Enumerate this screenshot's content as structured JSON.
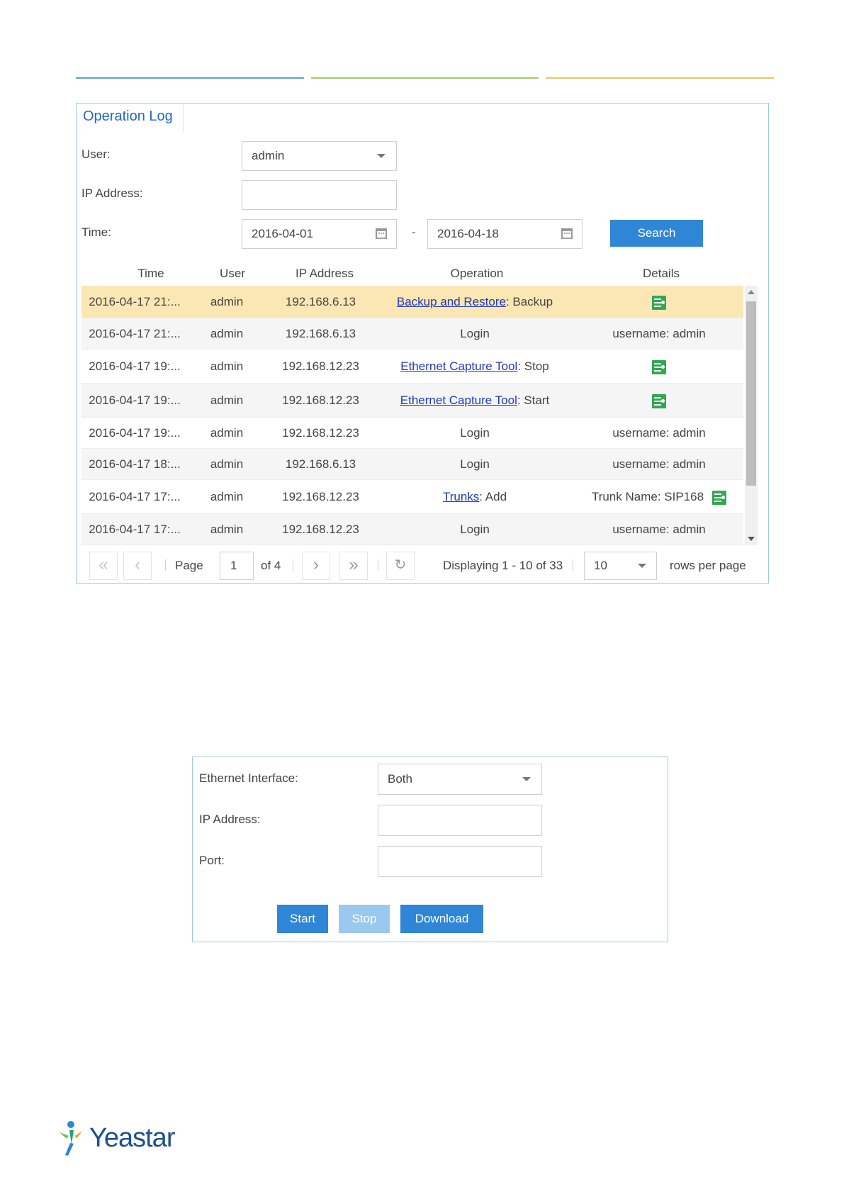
{
  "operation_log": {
    "title": "Operation Log",
    "user_label": "User:",
    "user_value": "admin",
    "ip_label": "IP Address:",
    "ip_value": "",
    "time_label": "Time:",
    "time_from": "2016-04-01",
    "time_separator": "-",
    "time_to": "2016-04-18",
    "search_label": "Search",
    "columns": [
      "Time",
      "User",
      "IP Address",
      "Operation",
      "Details"
    ],
    "rows": [
      {
        "time": "2016-04-17 21:...",
        "user": "admin",
        "ip": "192.168.6.13",
        "op_link": "Backup and Restore",
        "op_text": ": Backup",
        "details": "",
        "details_icon": "log-detail-icon"
      },
      {
        "time": "2016-04-17 21:...",
        "user": "admin",
        "ip": "192.168.6.13",
        "op_link": "",
        "op_text": "Login",
        "details": "username: admin",
        "details_icon": ""
      },
      {
        "time": "2016-04-17 19:...",
        "user": "admin",
        "ip": "192.168.12.23",
        "op_link": "Ethernet Capture Tool",
        "op_text": ": Stop",
        "details": "",
        "details_icon": "log-detail-icon"
      },
      {
        "time": "2016-04-17 19:...",
        "user": "admin",
        "ip": "192.168.12.23",
        "op_link": "Ethernet Capture Tool",
        "op_text": ": Start",
        "details": "",
        "details_icon": "log-detail-icon"
      },
      {
        "time": "2016-04-17 19:...",
        "user": "admin",
        "ip": "192.168.12.23",
        "op_link": "",
        "op_text": "Login",
        "details": "username: admin",
        "details_icon": ""
      },
      {
        "time": "2016-04-17 18:...",
        "user": "admin",
        "ip": "192.168.6.13",
        "op_link": "",
        "op_text": "Login",
        "details": "username: admin",
        "details_icon": ""
      },
      {
        "time": "2016-04-17 17:...",
        "user": "admin",
        "ip": "192.168.12.23",
        "op_link": "Trunks",
        "op_text": ": Add",
        "details": "Trunk Name: SIP168",
        "details_icon": "log-detail-icon"
      },
      {
        "time": "2016-04-17 17:...",
        "user": "admin",
        "ip": "192.168.12.23",
        "op_link": "",
        "op_text": "Login",
        "details": "username: admin",
        "details_icon": ""
      }
    ],
    "pager": {
      "page_label": "Page",
      "page_value": "1",
      "of_label": "of 4",
      "display_text": "Displaying 1 - 10 of 33",
      "rows_value": "10",
      "rows_label": "rows per page"
    }
  },
  "capture_tool": {
    "interface_label": "Ethernet Interface:",
    "interface_value": "Both",
    "ip_label": "IP Address:",
    "ip_value": "",
    "port_label": "Port:",
    "port_value": "",
    "start_label": "Start",
    "stop_label": "Stop",
    "download_label": "Download"
  },
  "logo": {
    "text": "Yeastar"
  },
  "colors": {
    "accent": "#2f86d6",
    "link": "#1f38b8",
    "selected_row": "#fbe7b3",
    "panel_border": "#9cc9e0"
  }
}
